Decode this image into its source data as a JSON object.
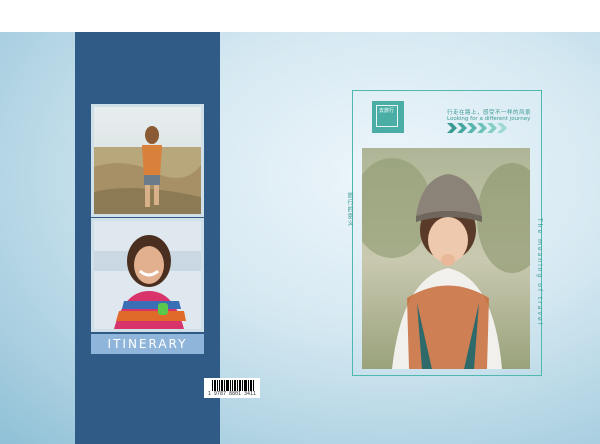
{
  "spine": {
    "label": "ITINERARY",
    "barcode_number": "1 9787 8801 3411"
  },
  "cover": {
    "logo_text": "去旅行",
    "chinese_caption": "行走在路上，感受不一样的风景",
    "english_caption": "Looking for a different journey",
    "vertical_left": "旅行的意义",
    "vertical_right": "The meaning of travel"
  },
  "colors": {
    "spine": "#2f5b86",
    "accent": "#4aaea6",
    "label_bg": "#8fb6da"
  }
}
